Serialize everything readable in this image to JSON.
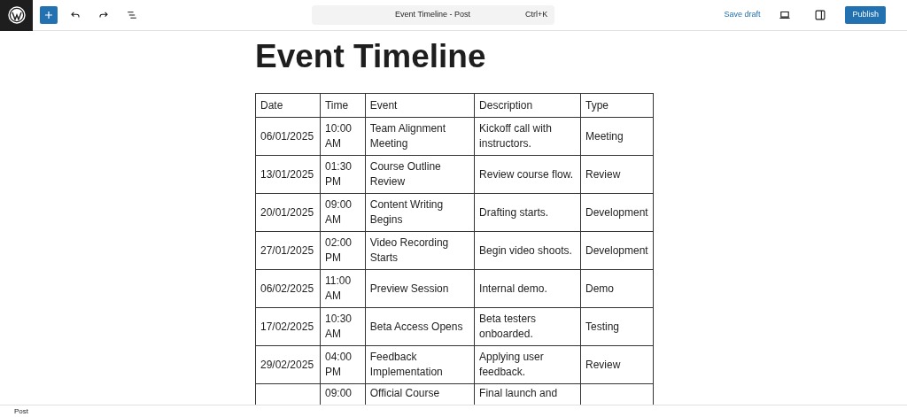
{
  "toolbar": {
    "command_bar": {
      "title": "Event Timeline - Post",
      "shortcut": "Ctrl+K"
    },
    "save_draft": "Save draft",
    "publish": "Publish"
  },
  "post": {
    "title": "Event Timeline",
    "table": {
      "columns": [
        "Date",
        "Time",
        "Event",
        "Description",
        "Type"
      ],
      "rows": [
        [
          "06/01/2025",
          "10:00 AM",
          "Team Alignment Meeting",
          "Kickoff call with instructors.",
          "Meeting"
        ],
        [
          "13/01/2025",
          "01:30 PM",
          "Course Outline Review",
          "Review course flow.",
          "Review"
        ],
        [
          "20/01/2025",
          "09:00 AM",
          "Content Writing Begins",
          "Drafting starts.",
          "Development"
        ],
        [
          "27/01/2025",
          "02:00 PM",
          "Video Recording Starts",
          "Begin video shoots.",
          "Development"
        ],
        [
          "06/02/2025",
          "11:00 AM",
          "Preview Session",
          "Internal demo.",
          "Demo"
        ],
        [
          "17/02/2025",
          "10:30 AM",
          "Beta Access Opens",
          "Beta testers onboarded.",
          "Testing"
        ],
        [
          "29/02/2025",
          "04:00 PM",
          "Feedback Implementation",
          "Applying user feedback.",
          "Review"
        ],
        [
          "",
          "09:00",
          "Official Course",
          "Final launch and",
          ""
        ]
      ]
    }
  },
  "status_bar": "Post"
}
